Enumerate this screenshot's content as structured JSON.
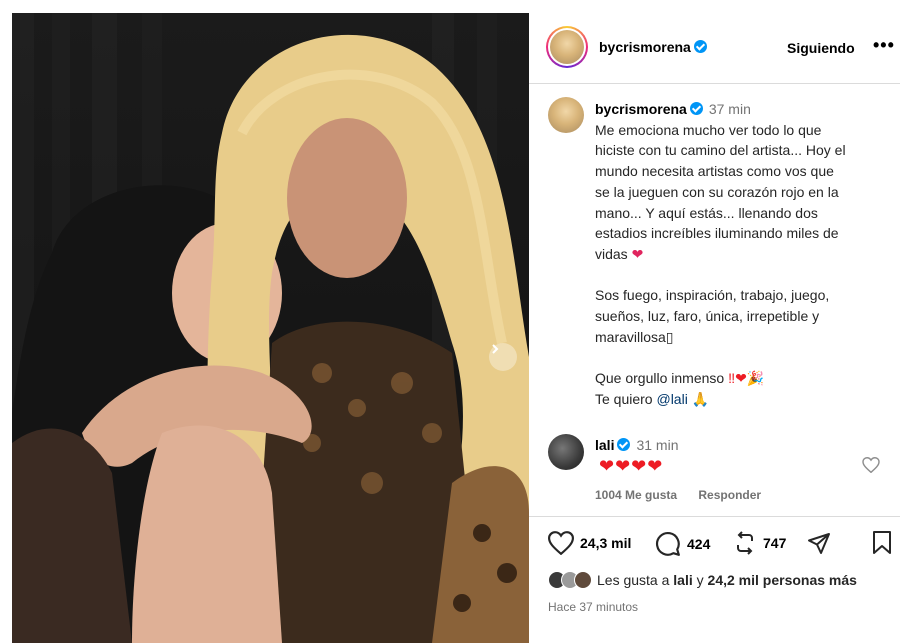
{
  "post": {
    "author": "bycrismorena",
    "follow_status": "Siguiendo",
    "more": "•••",
    "caption_time": "37 min",
    "caption_lines": [
      "Me emociona mucho ver todo lo que",
      "hiciste con tu camino del artista... Hoy el",
      "mundo necesita artistas como vos que",
      "se la jueguen con su corazón rojo en la",
      "mano... Y aquí estás... llenando dos",
      "estadios increíbles iluminando miles de",
      "vidas"
    ],
    "caption_heart": "❤",
    "caption_para2": [
      "Sos fuego, inspiración, trabajo, juego,",
      "sueños, luz, faro, única, irrepetible y",
      "maravillosa▯"
    ],
    "caption_para3_text": "Que orgullo inmenso",
    "caption_para3_emoji": "‼❤🎉",
    "caption_para4_text": "Te quiero",
    "caption_mention": "@lali",
    "caption_para4_emoji": "🙏"
  },
  "comment": {
    "author": "lali",
    "time": "31 min",
    "text": "❤❤❤❤",
    "likes": "1004 Me gusta",
    "reply": "Responder"
  },
  "actions": {
    "likes_count": "24,3 mil",
    "comments_count": "424",
    "reposts_count": "747"
  },
  "likes_summary": {
    "prefix": "Les gusta a",
    "user": "lali",
    "connector": "y",
    "others": "24,2 mil personas más"
  },
  "posted_ago": "Hace 37 minutos",
  "colors": {
    "link": "#00376b",
    "verified": "#0095f6",
    "secondary": "#737373",
    "heart": "#ed1c24"
  }
}
